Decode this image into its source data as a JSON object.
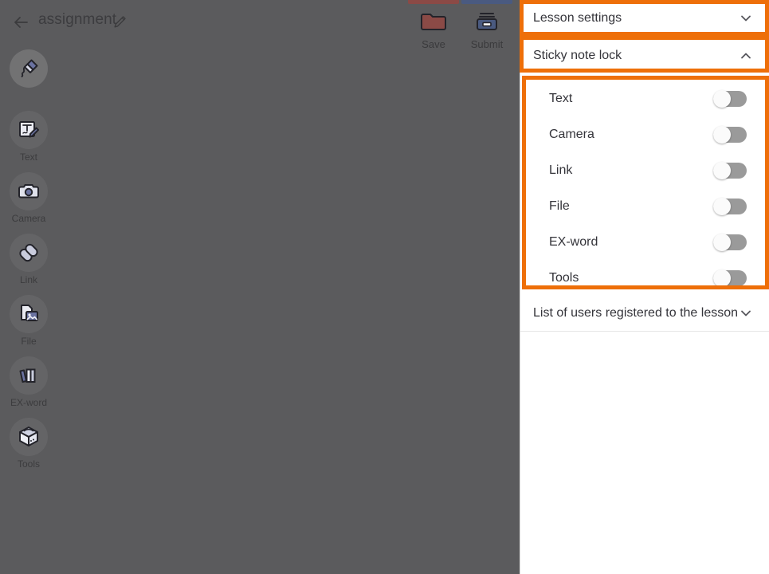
{
  "editor": {
    "title": "assignment",
    "back_icon": "back-arrow-icon",
    "edit_icon": "pencil-edit-icon",
    "actions": [
      {
        "label": "Save",
        "icon": "folder-icon",
        "accent": "#8b4a46"
      },
      {
        "label": "Submit",
        "icon": "printer-icon",
        "accent": "#4a5a80"
      }
    ]
  },
  "toolbar": {
    "items": [
      {
        "label": "",
        "icon": "marker-pen-icon",
        "active": true
      },
      {
        "label": "Text",
        "icon": "text-note-icon",
        "active": false
      },
      {
        "label": "Camera",
        "icon": "camera-icon",
        "active": false
      },
      {
        "label": "Link",
        "icon": "link-chain-icon",
        "active": false
      },
      {
        "label": "File",
        "icon": "file-image-icon",
        "active": false
      },
      {
        "label": "EX-word",
        "icon": "books-icon",
        "active": false
      },
      {
        "label": "Tools",
        "icon": "toolbox-icon",
        "active": false
      }
    ]
  },
  "panel": {
    "lesson_settings": {
      "title": "Lesson settings",
      "chevron": "chevron-down-icon",
      "expanded": false
    },
    "sticky_note_lock": {
      "title": "Sticky note lock",
      "chevron": "chevron-up-icon",
      "expanded": true,
      "toggles": [
        {
          "label": "Text",
          "state": "off"
        },
        {
          "label": "Camera",
          "state": "off"
        },
        {
          "label": "Link",
          "state": "off"
        },
        {
          "label": "File",
          "state": "off"
        },
        {
          "label": "EX-word",
          "state": "off"
        },
        {
          "label": "Tools",
          "state": "off"
        }
      ]
    },
    "users_list": {
      "title": "List of users registered to the lesson",
      "chevron": "chevron-down-icon",
      "expanded": false
    }
  },
  "highlights": {
    "color": "#ee6f09",
    "regions": [
      "lesson-settings-header",
      "sticky-note-lock-header",
      "sticky-note-lock-toggles"
    ]
  }
}
